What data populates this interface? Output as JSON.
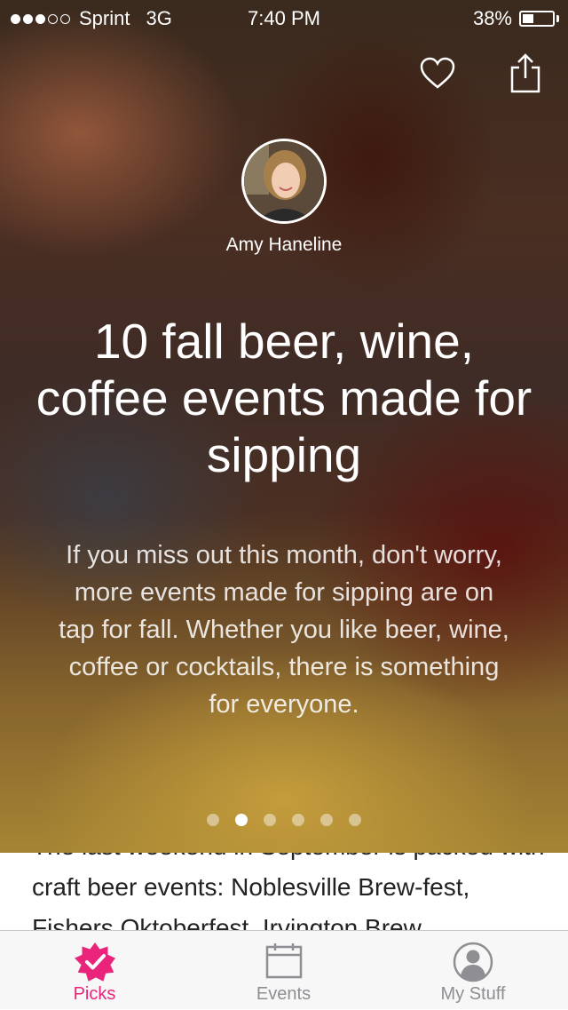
{
  "status_bar": {
    "carrier": "Sprint",
    "network": "3G",
    "time": "7:40 PM",
    "battery": "38%"
  },
  "story": {
    "author": "Amy Haneline",
    "headline": "10 fall beer, wine, coffee events made for sipping",
    "dek": "If you miss out this month, don't worry, more events made for sipping are on tap for fall. Whether you like beer, wine, coffee or cocktails, there is something for everyone.",
    "body": "The last weekend in September is packed with craft beer events: Noblesville Brew-fest, Fishers Oktoberfest, Irvington Brew",
    "page_count": 6,
    "active_page": 2
  },
  "tabbar": {
    "items": [
      {
        "label": "Picks"
      },
      {
        "label": "Events"
      },
      {
        "label": "My Stuff"
      }
    ]
  },
  "colors": {
    "accent": "#e9247a",
    "tab_inactive": "#8e8e93"
  },
  "icons": [
    "heart-icon",
    "share-icon",
    "picks-badge-icon",
    "calendar-icon",
    "profile-icon"
  ]
}
